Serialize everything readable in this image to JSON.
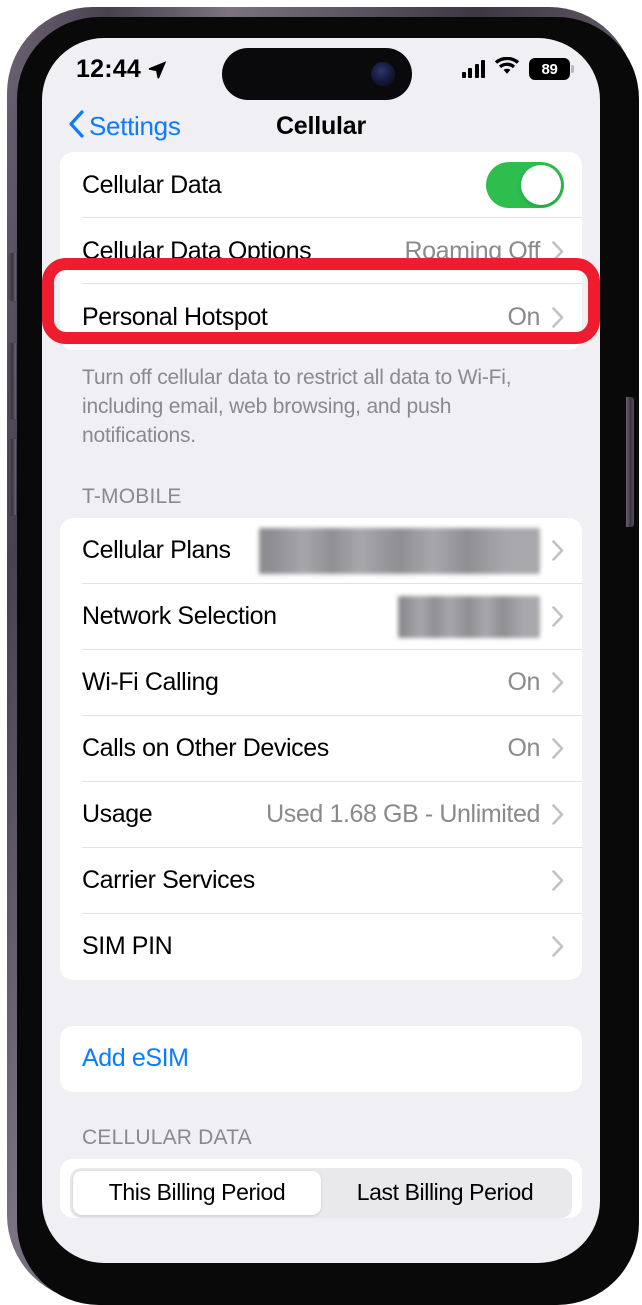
{
  "status_bar": {
    "time": "12:44",
    "location_icon": "location-arrow-icon",
    "signal_icon": "cellular-signal-icon",
    "wifi_icon": "wifi-icon",
    "battery_level": "89"
  },
  "nav": {
    "back_label": "Settings",
    "back_icon": "chevron-left-icon",
    "title": "Cellular"
  },
  "sections": {
    "main": {
      "rows": [
        {
          "label": "Cellular Data",
          "value": "",
          "control": "toggle",
          "toggle_on": true
        },
        {
          "label": "Cellular Data Options",
          "value": "Roaming Off",
          "control": "chevron"
        },
        {
          "label": "Personal Hotspot",
          "value": "On",
          "control": "chevron"
        }
      ],
      "footer": "Turn off cellular data to restrict all data to Wi-Fi, including email, web browsing, and push notifications."
    },
    "carrier": {
      "header": "T-MOBILE",
      "rows": [
        {
          "label": "Cellular Plans",
          "value": "",
          "control": "chevron",
          "redacted": "wide"
        },
        {
          "label": "Network Selection",
          "value": "",
          "control": "chevron",
          "redacted": "narrow"
        },
        {
          "label": "Wi-Fi Calling",
          "value": "On",
          "control": "chevron"
        },
        {
          "label": "Calls on Other Devices",
          "value": "On",
          "control": "chevron"
        },
        {
          "label": "Usage",
          "value": "Used 1.68 GB - Unlimited",
          "control": "chevron"
        },
        {
          "label": "Carrier Services",
          "value": "",
          "control": "chevron"
        },
        {
          "label": "SIM PIN",
          "value": "",
          "control": "chevron"
        }
      ]
    },
    "add_esim": {
      "label": "Add eSIM"
    },
    "cellular_data": {
      "header": "CELLULAR DATA",
      "segments": [
        {
          "label": "This Billing Period",
          "selected": true
        },
        {
          "label": "Last Billing Period",
          "selected": false
        }
      ]
    }
  },
  "annotation": {
    "type": "highlight-rectangle",
    "color": "#ee1c2e",
    "target": "Cellular Data Options"
  },
  "colors": {
    "accent_blue": "#0a7cff",
    "toggle_green": "#2dbe4e",
    "annotation_red": "#ee1c2e",
    "page_background": "#efeff4",
    "card_background": "#ffffff",
    "secondary_text": "#8a8a8e"
  }
}
